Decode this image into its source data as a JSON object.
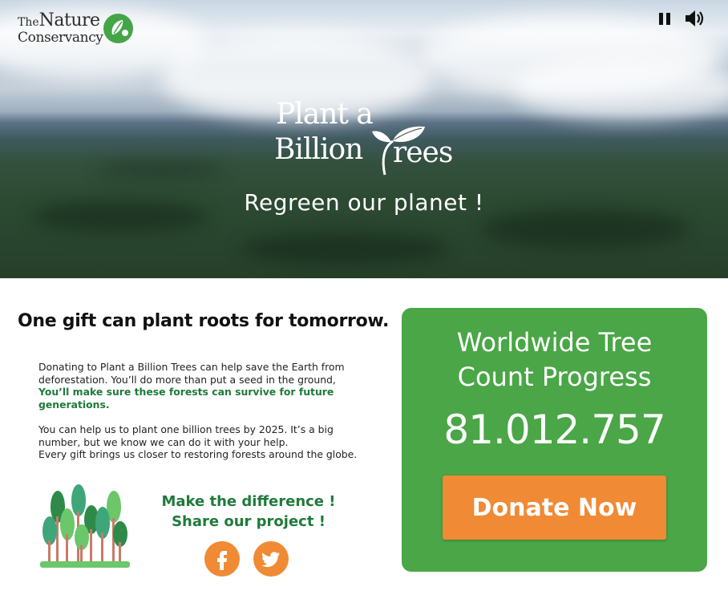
{
  "brand": {
    "logo_line1_prefix": "The",
    "logo_line1_word": "Nature",
    "logo_line2": "Conservancy"
  },
  "hero": {
    "logo_line1": "Plant a",
    "logo_line2_part1": "Billion",
    "logo_line2_part2": "rees",
    "tagline": "Regreen our planet !",
    "controls": [
      "pause-icon",
      "volume-icon"
    ]
  },
  "content": {
    "headline": "One gift can plant roots for tomorrow.",
    "para1_text": "Donating to Plant a Billion Trees can help save the Earth from deforestation. You’ll do more than put a seed in the ground,",
    "para1_bold": " You’ll make sure these forests can survive for future generations.",
    "para2_line1": "You can help us to plant one billion trees by 2025. It’s a big number, but we know we can do it with your help.",
    "para2_line2": "Every gift brings us closer to restoring forests around the globe.",
    "share_line1": "Make the difference !",
    "share_line2": "Share our project !",
    "social": [
      "facebook-icon",
      "twitter-icon"
    ]
  },
  "card": {
    "title_line1": "Worldwide Tree",
    "title_line2": "Count Progress",
    "count": "81.012.757",
    "donate_label": "Donate Now"
  },
  "colors": {
    "brand_green": "#4aa646",
    "dark_green": "#1f7a3a",
    "accent_orange": "#f08a34"
  }
}
